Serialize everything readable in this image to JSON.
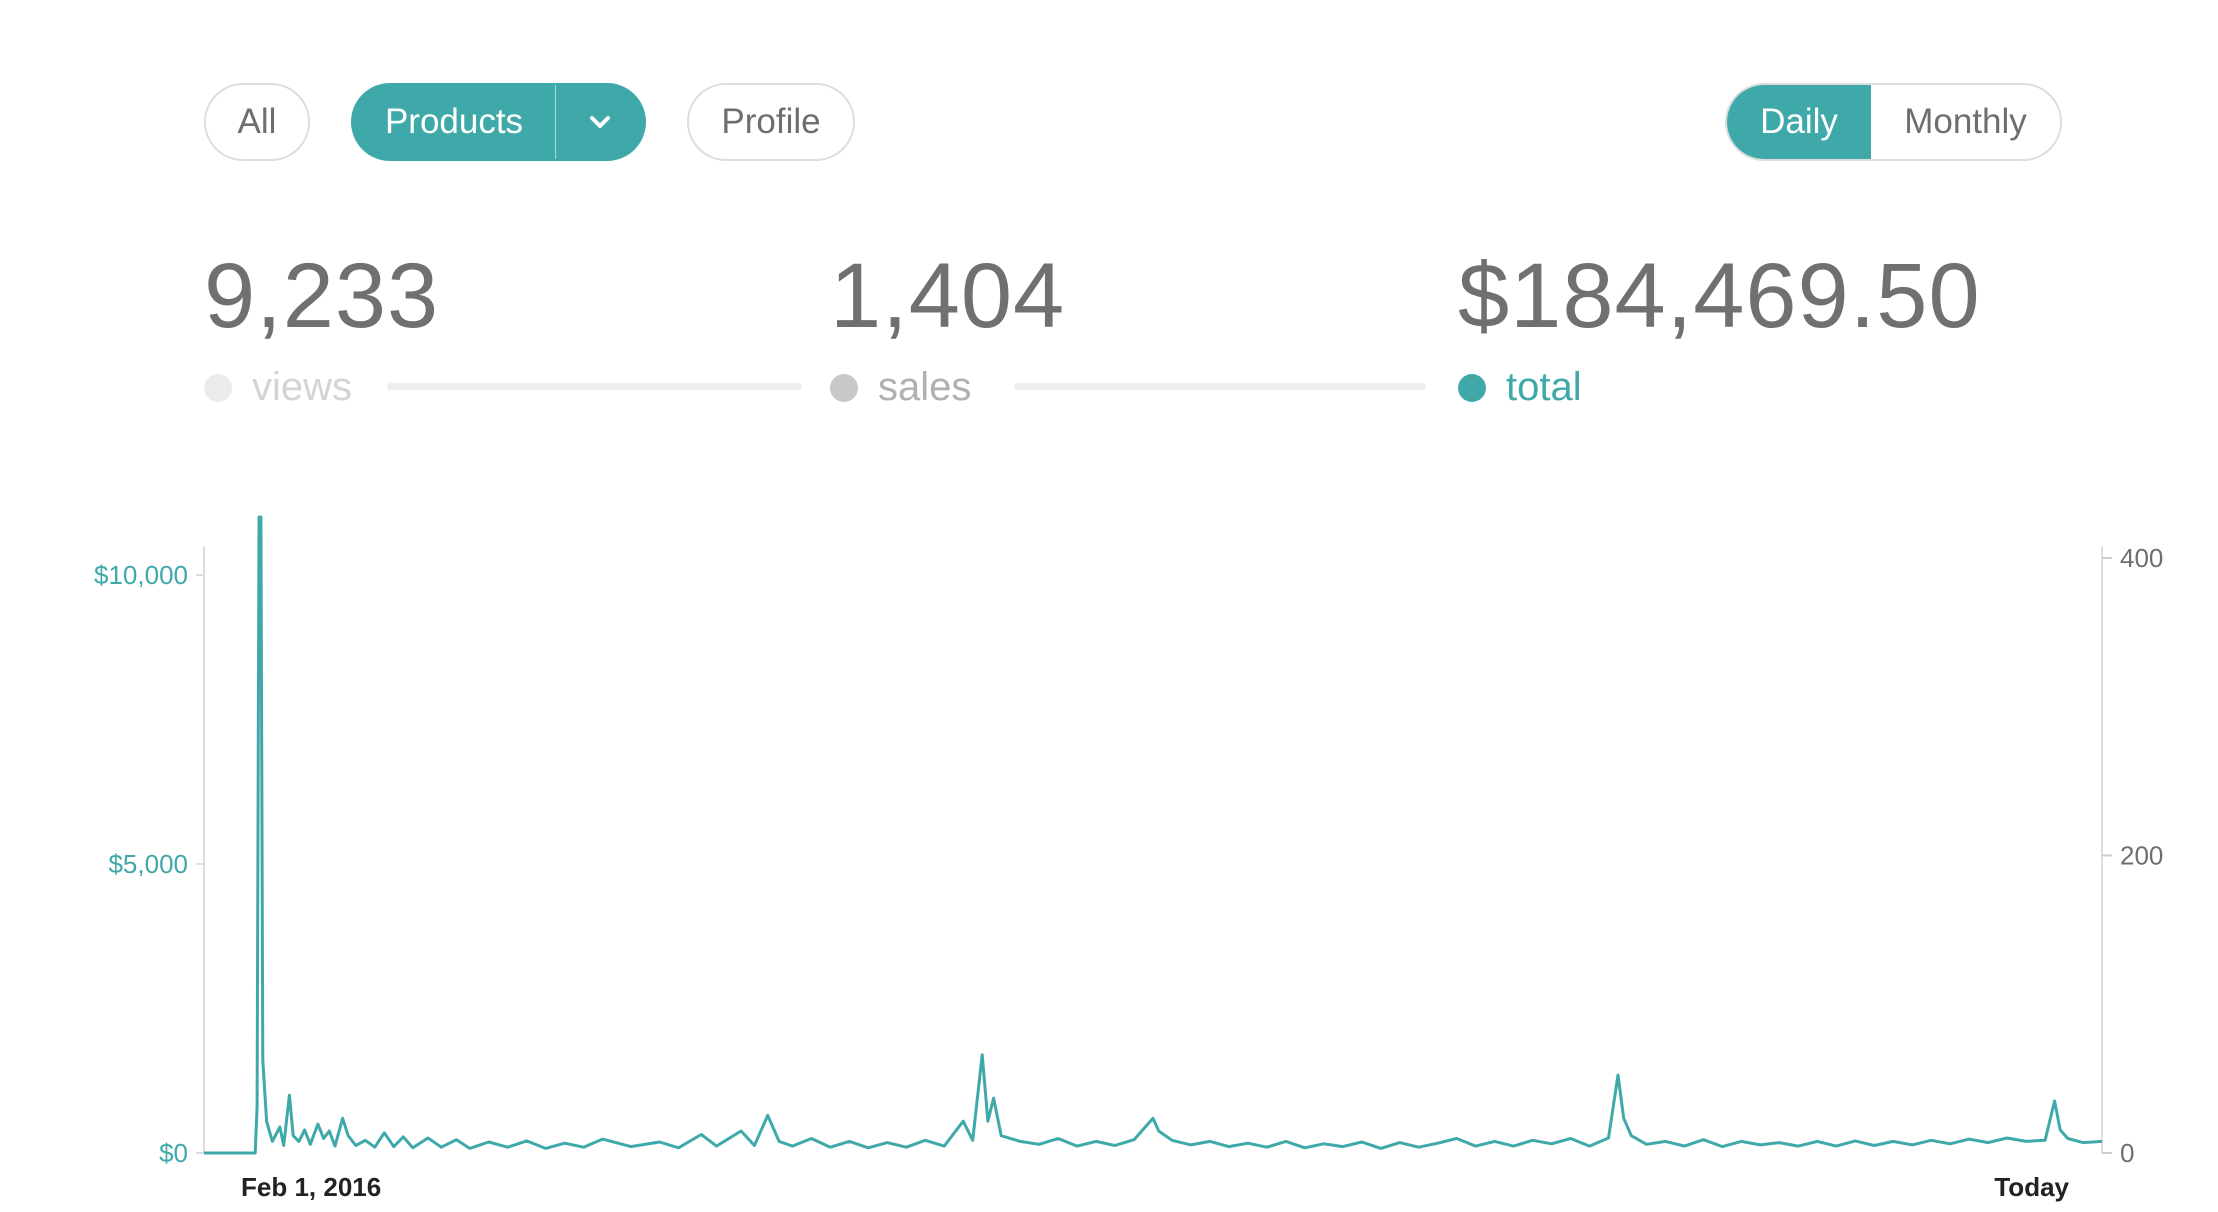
{
  "filters": {
    "all_label": "All",
    "products_label": "Products",
    "profile_label": "Profile",
    "active": "Products",
    "products_dropdown_icon": "chevron-down-icon"
  },
  "period_toggle": {
    "daily_label": "Daily",
    "monthly_label": "Monthly",
    "active": "Daily"
  },
  "stats": {
    "views": {
      "value": "9,233",
      "label": "views"
    },
    "sales": {
      "value": "1,404",
      "label": "sales"
    },
    "total": {
      "value": "$184,469.50",
      "label": "total"
    }
  },
  "colors": {
    "accent": "#3fa9aa",
    "inactive_dot": "#c8c8c8",
    "muted_dot": "#ececec"
  },
  "chart_data": {
    "type": "line",
    "x_labels": [
      "Feb 1, 2016",
      "Today"
    ],
    "y_left": {
      "ticks": [
        "$0",
        "$5,000",
        "$10,000"
      ],
      "values": [
        0,
        5000,
        10000
      ],
      "range": [
        0,
        10500
      ]
    },
    "y_right": {
      "ticks": [
        "0",
        "200",
        "400"
      ],
      "values": [
        0,
        200,
        400
      ],
      "range": [
        0,
        400
      ]
    },
    "grid": false,
    "series": [
      {
        "color": "#3fa9aa",
        "axis": "left",
        "points": [
          [
            0,
            0
          ],
          [
            0.027,
            0
          ],
          [
            0.028,
            800
          ],
          [
            0.029,
            11000
          ],
          [
            0.03,
            11000
          ],
          [
            0.031,
            1600
          ],
          [
            0.033,
            550
          ],
          [
            0.036,
            200
          ],
          [
            0.04,
            450
          ],
          [
            0.042,
            130
          ],
          [
            0.045,
            1000
          ],
          [
            0.047,
            300
          ],
          [
            0.05,
            200
          ],
          [
            0.053,
            400
          ],
          [
            0.056,
            150
          ],
          [
            0.06,
            500
          ],
          [
            0.063,
            250
          ],
          [
            0.066,
            380
          ],
          [
            0.069,
            120
          ],
          [
            0.073,
            600
          ],
          [
            0.076,
            300
          ],
          [
            0.08,
            130
          ],
          [
            0.085,
            220
          ],
          [
            0.09,
            100
          ],
          [
            0.095,
            350
          ],
          [
            0.1,
            110
          ],
          [
            0.105,
            280
          ],
          [
            0.11,
            90
          ],
          [
            0.118,
            260
          ],
          [
            0.125,
            100
          ],
          [
            0.133,
            230
          ],
          [
            0.14,
            80
          ],
          [
            0.15,
            190
          ],
          [
            0.16,
            100
          ],
          [
            0.17,
            210
          ],
          [
            0.18,
            80
          ],
          [
            0.19,
            170
          ],
          [
            0.2,
            100
          ],
          [
            0.21,
            240
          ],
          [
            0.225,
            110
          ],
          [
            0.24,
            190
          ],
          [
            0.25,
            90
          ],
          [
            0.262,
            320
          ],
          [
            0.27,
            120
          ],
          [
            0.283,
            380
          ],
          [
            0.29,
            130
          ],
          [
            0.297,
            650
          ],
          [
            0.303,
            200
          ],
          [
            0.31,
            120
          ],
          [
            0.32,
            250
          ],
          [
            0.33,
            100
          ],
          [
            0.34,
            200
          ],
          [
            0.35,
            90
          ],
          [
            0.36,
            180
          ],
          [
            0.37,
            100
          ],
          [
            0.38,
            220
          ],
          [
            0.39,
            120
          ],
          [
            0.4,
            550
          ],
          [
            0.405,
            220
          ],
          [
            0.41,
            1700
          ],
          [
            0.413,
            550
          ],
          [
            0.416,
            950
          ],
          [
            0.42,
            300
          ],
          [
            0.43,
            200
          ],
          [
            0.44,
            150
          ],
          [
            0.45,
            250
          ],
          [
            0.46,
            120
          ],
          [
            0.47,
            200
          ],
          [
            0.48,
            130
          ],
          [
            0.49,
            230
          ],
          [
            0.5,
            600
          ],
          [
            0.503,
            380
          ],
          [
            0.51,
            220
          ],
          [
            0.52,
            140
          ],
          [
            0.53,
            200
          ],
          [
            0.54,
            110
          ],
          [
            0.55,
            170
          ],
          [
            0.56,
            100
          ],
          [
            0.57,
            200
          ],
          [
            0.58,
            90
          ],
          [
            0.59,
            160
          ],
          [
            0.6,
            110
          ],
          [
            0.61,
            190
          ],
          [
            0.62,
            80
          ],
          [
            0.63,
            180
          ],
          [
            0.64,
            100
          ],
          [
            0.65,
            170
          ],
          [
            0.66,
            250
          ],
          [
            0.67,
            120
          ],
          [
            0.68,
            200
          ],
          [
            0.69,
            120
          ],
          [
            0.7,
            220
          ],
          [
            0.71,
            160
          ],
          [
            0.72,
            250
          ],
          [
            0.73,
            120
          ],
          [
            0.74,
            260
          ],
          [
            0.745,
            1350
          ],
          [
            0.748,
            600
          ],
          [
            0.752,
            300
          ],
          [
            0.76,
            150
          ],
          [
            0.77,
            200
          ],
          [
            0.78,
            120
          ],
          [
            0.79,
            230
          ],
          [
            0.8,
            110
          ],
          [
            0.81,
            200
          ],
          [
            0.82,
            140
          ],
          [
            0.83,
            180
          ],
          [
            0.84,
            120
          ],
          [
            0.85,
            200
          ],
          [
            0.86,
            120
          ],
          [
            0.87,
            210
          ],
          [
            0.88,
            130
          ],
          [
            0.89,
            200
          ],
          [
            0.9,
            140
          ],
          [
            0.91,
            220
          ],
          [
            0.92,
            160
          ],
          [
            0.93,
            240
          ],
          [
            0.94,
            180
          ],
          [
            0.95,
            260
          ],
          [
            0.96,
            200
          ],
          [
            0.97,
            220
          ],
          [
            0.975,
            900
          ],
          [
            0.978,
            400
          ],
          [
            0.982,
            250
          ],
          [
            0.99,
            180
          ],
          [
            1.0,
            200
          ]
        ]
      }
    ]
  }
}
